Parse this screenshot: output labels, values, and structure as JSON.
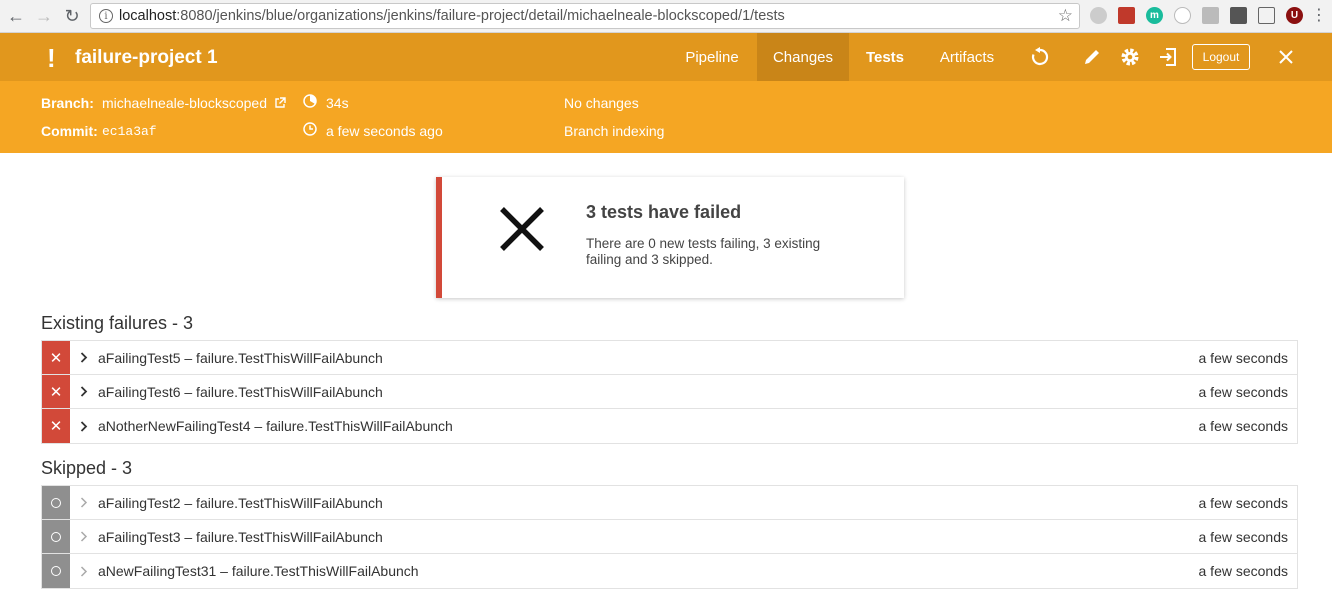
{
  "browser": {
    "url_host": "localhost",
    "url_rest": ":8080/jenkins/blue/organizations/jenkins/failure-project/detail/michaelneale-blockscoped/1/tests"
  },
  "header": {
    "title": "failure-project 1",
    "tabs": [
      {
        "label": "Pipeline"
      },
      {
        "label": "Changes"
      },
      {
        "label": "Tests"
      },
      {
        "label": "Artifacts"
      }
    ],
    "logout_label": "Logout",
    "colors": {
      "topbar": "#e1971d",
      "metabar": "#f5a623"
    }
  },
  "meta": {
    "branch_label": "Branch:",
    "branch_value": "michaelneale-blockscoped",
    "commit_label": "Commit:",
    "commit_value": "ec1a3af",
    "duration": "34s",
    "started": "a few seconds ago",
    "changes": "No changes",
    "cause": "Branch indexing"
  },
  "summary": {
    "title": "3 tests have failed",
    "text": "There are 0 new tests failing, 3 existing failing and 3 skipped."
  },
  "failures": {
    "title": "Existing failures - 3",
    "rows": [
      {
        "name": "aFailingTest5 – failure.TestThisWillFailAbunch",
        "duration": "a few seconds"
      },
      {
        "name": "aFailingTest6 – failure.TestThisWillFailAbunch",
        "duration": "a few seconds"
      },
      {
        "name": "aNotherNewFailingTest4 – failure.TestThisWillFailAbunch",
        "duration": "a few seconds"
      }
    ]
  },
  "skipped": {
    "title": "Skipped - 3",
    "rows": [
      {
        "name": "aFailingTest2 – failure.TestThisWillFailAbunch",
        "duration": "a few seconds"
      },
      {
        "name": "aFailingTest3 – failure.TestThisWillFailAbunch",
        "duration": "a few seconds"
      },
      {
        "name": "aNewFailingTest31 – failure.TestThisWillFailAbunch",
        "duration": "a few seconds"
      }
    ]
  }
}
